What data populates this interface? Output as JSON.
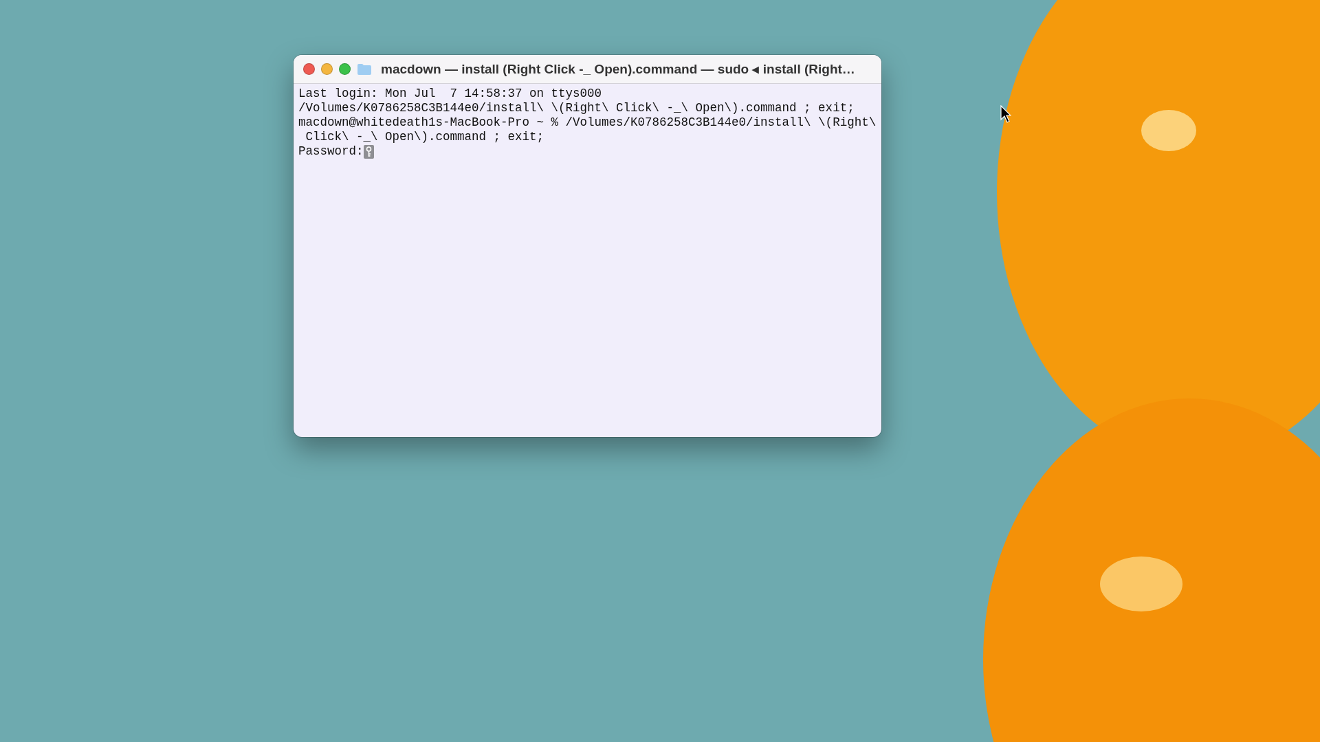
{
  "window": {
    "title": "macdown — install (Right Click -_ Open).command — sudo ◂ install (Right…"
  },
  "terminal": {
    "lines": [
      "Last login: Mon Jul  7 14:58:37 on ttys000",
      "/Volumes/K0786258C3B144e0/install\\ \\(Right\\ Click\\ -_\\ Open\\).command ; exit;",
      "macdown@whitedeath1s-MacBook-Pro ~ % /Volumes/K0786258C3B144e0/install\\ \\(Right\\",
      " Click\\ -_\\ Open\\).command ; exit;"
    ],
    "prompt": "Password:"
  }
}
